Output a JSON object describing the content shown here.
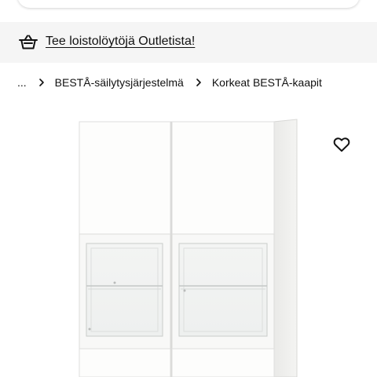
{
  "promo": {
    "text": "Tee loistolöytöjä Outletista!",
    "icon": "basket-icon"
  },
  "breadcrumb": {
    "ellipsis": "...",
    "items": [
      {
        "label": "BESTÅ-säilytysjärjestelmä"
      },
      {
        "label": "Korkeat BESTÅ-kaapit"
      }
    ]
  },
  "product": {
    "image": "white-cabinet-with-glass-doors",
    "favourite_icon": "heart-icon"
  },
  "colors": {
    "banner_bg": "#f5f5f5",
    "text": "#111111",
    "page_bg": "#ffffff"
  }
}
